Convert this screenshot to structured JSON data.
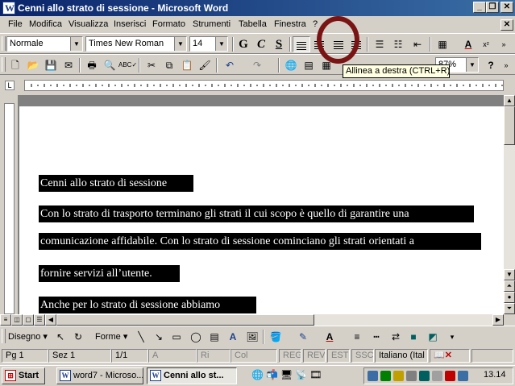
{
  "window": {
    "title": "Cenni allo strato di sessione - Microsoft Word"
  },
  "menu": [
    "File",
    "Modifica",
    "Visualizza",
    "Inserisci",
    "Formato",
    "Strumenti",
    "Tabella",
    "Finestra",
    "?"
  ],
  "formatting": {
    "style": "Normale",
    "font": "Times New Roman",
    "size": "14",
    "bold": "G",
    "italic": "C",
    "underline": "S"
  },
  "standard": {
    "zoom": "87%",
    "help": "?"
  },
  "tooltip": "Allinea a destra (CTRL+R)",
  "document": {
    "lines": [
      "Cenni allo strato di sessione",
      "Con lo strato di trasporto terminano gli strati il cui scopo è quello di garantire una",
      "comunicazione affidabile. Con lo strato di sessione cominciano gli strati orientati a",
      "fornire servizi all’utente.",
      "Anche per lo strato di sessione abbiamo"
    ]
  },
  "drawing": {
    "draw": "Disegno",
    "shapes": "Forme"
  },
  "status": {
    "page": "Pg 1",
    "section": "Sez 1",
    "pages": "1/1",
    "at": "A",
    "line": "Ri",
    "col": "Col",
    "rec": "REG",
    "rev": "REV",
    "ext": "EST",
    "ovr": "SSC",
    "language": "Italiano (Ital"
  },
  "taskbar": {
    "start": "Start",
    "tasks": [
      "word7 - Microso...",
      "Cenni allo st..."
    ],
    "clock": "13.14"
  },
  "colors": {
    "title_start": "#0a246a",
    "title_end": "#3a6ea5",
    "annotation_circle": "#7a1414",
    "selection": "#000000"
  }
}
